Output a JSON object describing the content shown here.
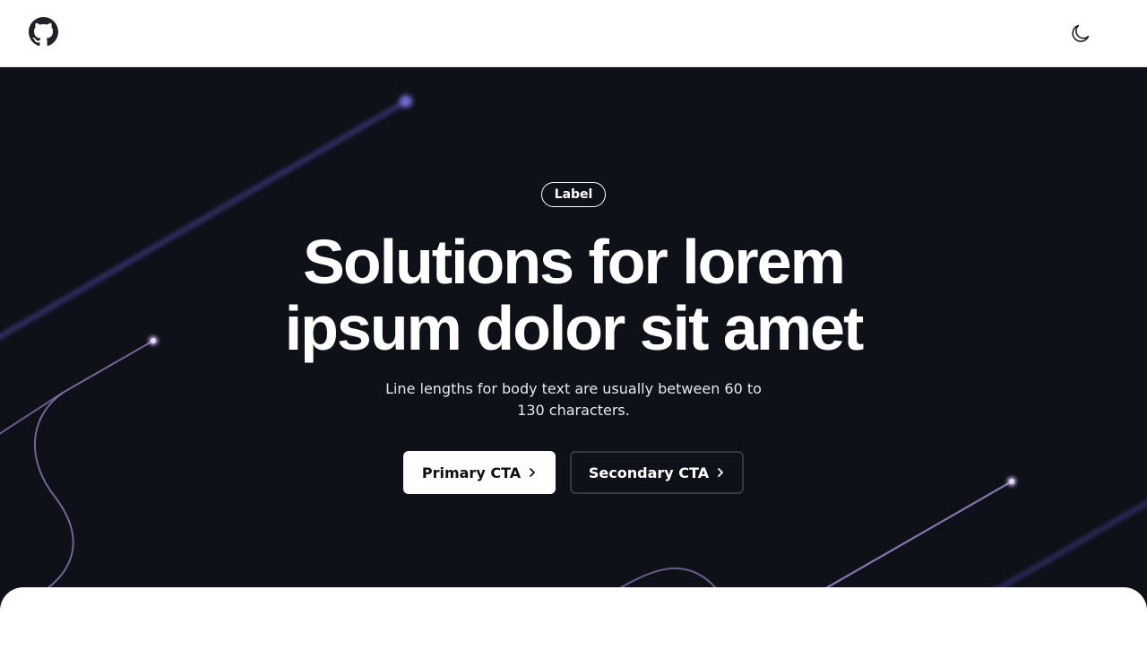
{
  "header": {
    "github_icon": "github-icon",
    "theme_icon": "moon-icon"
  },
  "hero": {
    "badge": "Label",
    "title": "Solutions for lorem ipsum dolor sit amet",
    "subtitle": "Line lengths for body text are usually between 60 to 130 characters.",
    "primary_cta": "Primary CTA",
    "secondary_cta": "Secondary CTA",
    "cta_icon": "chevron-right-icon"
  },
  "colors": {
    "background": "#0e1118",
    "accent": "#6b63d6",
    "line": "#9a86c9"
  }
}
